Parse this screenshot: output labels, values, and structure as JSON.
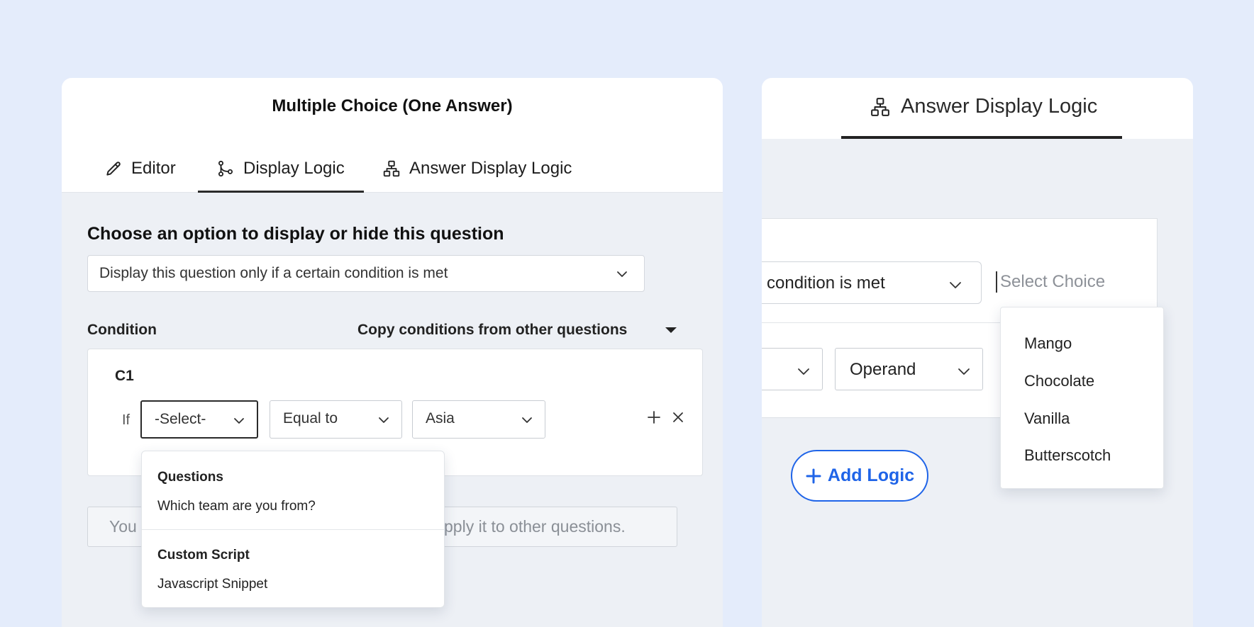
{
  "left_panel": {
    "title": "Multiple Choice (One Answer)",
    "tabs": [
      {
        "label": "Editor",
        "icon": "pencil-icon"
      },
      {
        "label": "Display Logic",
        "icon": "branch-icon",
        "active": true
      },
      {
        "label": "Answer Display Logic",
        "icon": "hierarchy-icon"
      }
    ],
    "heading": "Choose an option to display or hide this question",
    "display_option": "Display this question only if a certain condition is met",
    "condition_label": "Condition",
    "copy_conditions_label": "Copy conditions from other questions",
    "condition": {
      "id": "C1",
      "if_label": "If",
      "question_select": "-Select-",
      "operator_select": "Equal to",
      "value_select": "Asia"
    },
    "info_text_left": "You",
    "info_text_right": "pply it to other questions.",
    "dropdown": {
      "sections": [
        {
          "heading": "Questions",
          "items": [
            "Which team are you from?"
          ]
        },
        {
          "heading": "Custom Script",
          "items": [
            "Javascript Snippet"
          ]
        }
      ]
    }
  },
  "right_panel": {
    "tab_label": "Answer Display Logic",
    "tab_icon": "hierarchy-icon",
    "condition_select": "condition is met",
    "choice_placeholder": "Select Choice",
    "operand_select": "Operand",
    "add_logic_label": "Add Logic",
    "choices": [
      "Mango",
      "Chocolate",
      "Vanilla",
      "Butterscotch"
    ]
  },
  "colors": {
    "page_background": "#e4ecfb",
    "panel_background": "#edf0f5",
    "accent_blue": "#1f64e8",
    "active_tab_underline": "#2b2b2b"
  }
}
